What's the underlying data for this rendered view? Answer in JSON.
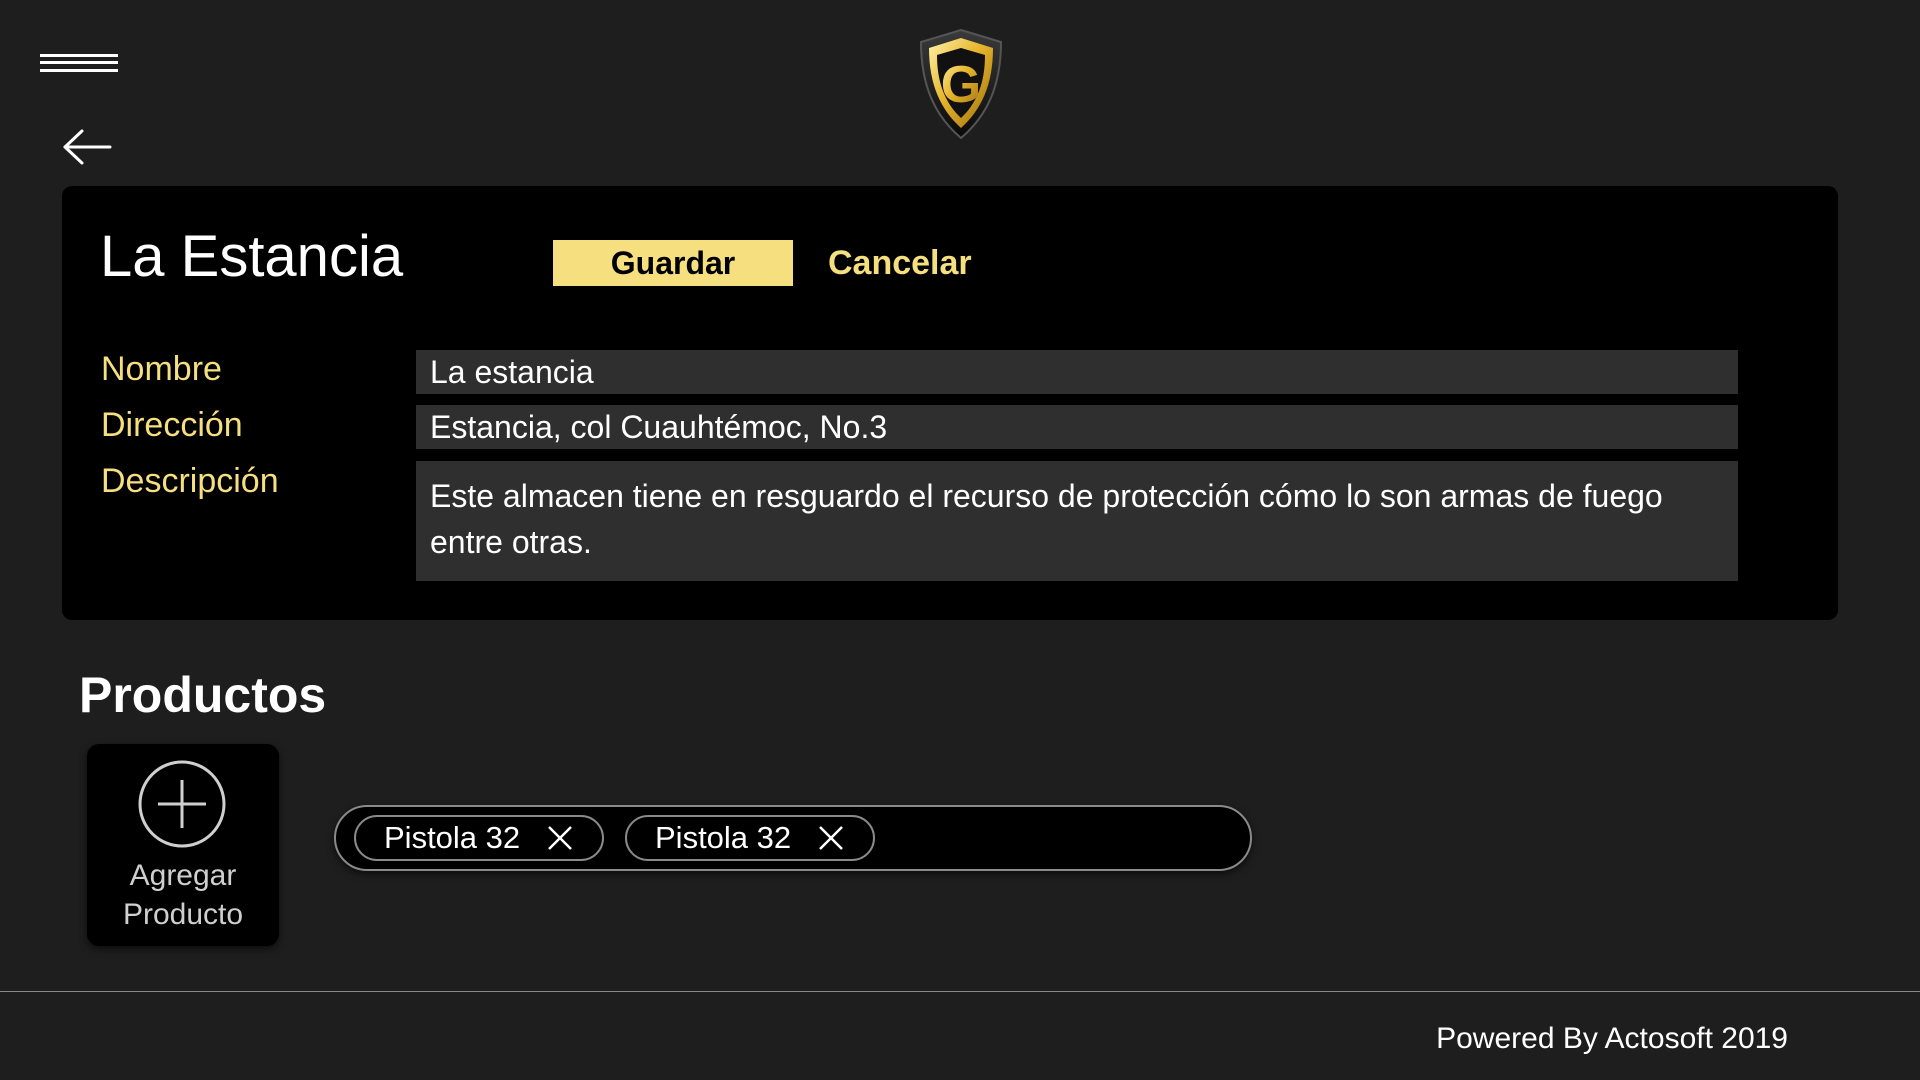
{
  "header": {
    "menu_icon": "hamburger-menu-icon",
    "back_icon": "arrow-left-icon",
    "logo_letter": "G"
  },
  "card": {
    "title": "La Estancia",
    "save_label": "Guardar",
    "cancel_label": "Cancelar",
    "fields": {
      "nombre": {
        "label": "Nombre",
        "value": "La estancia"
      },
      "direccion": {
        "label": "Dirección",
        "value": "Estancia, col Cuauhtémoc, No.3"
      },
      "descripcion": {
        "label": "Descripción",
        "value": "Este almacen tiene en resguardo el recurso de protección cómo lo son armas de fuego entre otras."
      }
    }
  },
  "products": {
    "section_title": "Productos",
    "add_label_line1": "Agregar",
    "add_label_line2": "Producto",
    "add_icon": "plus-circle-icon",
    "chips": [
      {
        "label": "Pistola 32",
        "icon": "close-icon"
      },
      {
        "label": "Pistola 32",
        "icon": "close-icon"
      }
    ]
  },
  "footer": {
    "text": "Powered By Actosoft 2019"
  },
  "colors": {
    "background": "#1e1e1e",
    "card": "#000000",
    "accent": "#f5df7e",
    "input_bg": "#2f2f2f",
    "border": "#8a8a8a"
  }
}
